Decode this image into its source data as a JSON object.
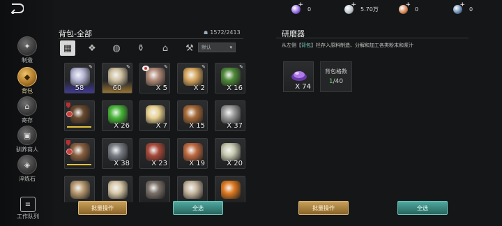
{
  "currencies": [
    {
      "name": "purple-gem",
      "value": "0",
      "color": "#8a5fe0"
    },
    {
      "name": "silver-coin",
      "value": "5.70万",
      "color": "#b8c0c8"
    },
    {
      "name": "copper-coin",
      "value": "0",
      "color": "#d07a4a"
    },
    {
      "name": "blue-crystal",
      "value": "0",
      "color": "#5a7fa8"
    }
  ],
  "nav": [
    {
      "label": "制造",
      "icon": "craft-icon",
      "active": false
    },
    {
      "label": "背包",
      "icon": "bag-icon",
      "active": true
    },
    {
      "label": "寄存",
      "icon": "storage-icon",
      "active": false
    },
    {
      "label": "驯养商人",
      "icon": "merchant-icon",
      "active": false
    },
    {
      "label": "淬炼石",
      "icon": "stone-icon",
      "active": false
    }
  ],
  "queue_label": "工作队列",
  "inventory": {
    "title": "背包-全部",
    "capacity": "1572/2413",
    "sort_label": "默认",
    "tabs": [
      "all-tab-icon",
      "material-tab-icon",
      "ore-tab-icon",
      "potion-tab-icon",
      "building-tab-icon",
      "tool-tab-icon"
    ],
    "items": [
      {
        "icon": "purple-shell-item-icon",
        "qty": "58",
        "center": true,
        "wrench": true,
        "bg": "blue",
        "color": "#b8b8d8"
      },
      {
        "icon": "gold-shell-item-icon",
        "qty": "60",
        "center": true,
        "wrench": true,
        "bg": "gold",
        "color": "#cfc0a0"
      },
      {
        "icon": "meat-item-icon",
        "qty": "X 5",
        "wrench": true,
        "lock": true,
        "color": "#b08a78"
      },
      {
        "icon": "egg-item-icon",
        "qty": "X 2",
        "wrench": true,
        "color": "#d8a860"
      },
      {
        "icon": "book-item-icon",
        "qty": "X 16",
        "wrench": true,
        "color": "#4f8a3a"
      },
      {
        "icon": "leather-armor-item-icon",
        "qty": "",
        "shield": true,
        "bar": true,
        "color": "#6a4a30"
      },
      {
        "icon": "herb-item-icon",
        "qty": "X 26",
        "color": "#4ab83a"
      },
      {
        "icon": "ginseng-item-icon",
        "qty": "X 7",
        "color": "#e8d090"
      },
      {
        "icon": "wood-log-item-icon",
        "qty": "X 15",
        "color": "#a86a38"
      },
      {
        "icon": "gear-item-icon",
        "qty": "X 37",
        "color": "#9a9a9a"
      },
      {
        "icon": "cloth-armor-item-icon",
        "qty": "",
        "shield": true,
        "bar": true,
        "color": "#8a6040"
      },
      {
        "icon": "iron-chunk-item-icon",
        "qty": "X 38",
        "color": "#7a7e86"
      },
      {
        "icon": "raw-meat-item-icon",
        "qty": "X 23",
        "color": "#a84a3a"
      },
      {
        "icon": "copper-ingot-item-icon",
        "qty": "X 19",
        "color": "#c06a40"
      },
      {
        "icon": "silver-ingot-item-icon",
        "qty": "X 20",
        "color": "#c8c8b0"
      },
      {
        "icon": "spear-item-icon",
        "qty": "",
        "color": "#b89a70"
      },
      {
        "icon": "bone-item-icon",
        "qty": "",
        "color": "#d8c8a8"
      },
      {
        "icon": "basket-item-icon",
        "qty": "",
        "color": "#7a7068"
      },
      {
        "icon": "fur-item-icon",
        "qty": "",
        "color": "#c8b8a0"
      },
      {
        "icon": "fire-item-icon",
        "qty": "",
        "color": "#e07a20"
      }
    ],
    "batch_label": "批量操作",
    "select_all_label": "全选"
  },
  "grinder": {
    "title": "研磨器",
    "desc_pre": "从左侧【",
    "desc_hl": "背包",
    "desc_post": "】栏存入原料制造、分解和加工各类粉末和浆汁",
    "output_qty": "X 74",
    "output_icon": "purple-powder-item-icon",
    "slot_label": "背包格数",
    "slot_used": "1",
    "slot_total": "/40",
    "batch_label": "批量操作",
    "select_all_label": "全选"
  }
}
